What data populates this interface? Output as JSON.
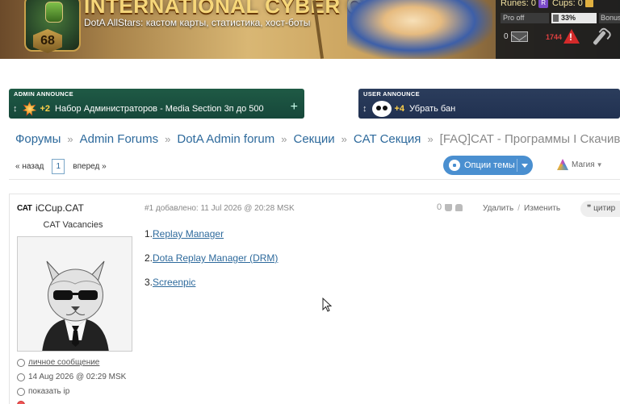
{
  "header": {
    "site_title": "INTERNATIONAL CYBER CUP",
    "site_subtitle": "DotA AllStars: кастом карты, статистика, хост-боты",
    "level": "68"
  },
  "user_panel": {
    "runes_label": "Runes: 0",
    "rune_icon_letter": "R",
    "cups_label": "Cups: 0",
    "pro_status": "Pro off",
    "armor": "33% Armor",
    "bonus": "Bonus",
    "messages": "0",
    "alerts": "1744"
  },
  "announcements": {
    "admin": {
      "tag": "ADMIN ANNOUNCE",
      "count": "+2",
      "text": "Набор Администраторов - Media Section 3п до 500",
      "expand": "+"
    },
    "user": {
      "tag": "USER ANNOUNCE",
      "count": "+4",
      "text": "Убрать бан"
    }
  },
  "breadcrumb": {
    "items": [
      "Форумы",
      "Admin Forums",
      "DotA Admin forum",
      "Секции",
      "CAT Секция"
    ],
    "current": "[FAQ]CAT - Программы I Скачива",
    "separator": "»"
  },
  "pager": {
    "prev": "« назад",
    "page": "1",
    "next": "вперед »"
  },
  "thread_options": {
    "label": "Опции темы"
  },
  "magic": {
    "label": "Магия"
  },
  "post": {
    "author_logo": "CAT",
    "author_name": "iCCup.CAT",
    "author_rank": "CAT Vacancies",
    "meta": "#1 добавлено: 11 Jul 2026 @ 20:28 MSK",
    "rating": "0",
    "delete": "Удалить",
    "edit": "Изменить",
    "actions_sep": "/",
    "quote": "цитир",
    "profile": {
      "pm": "личное сообщение",
      "date": "14 Aug 2026 @ 02:29 MSK",
      "ip": "показать ip"
    },
    "items": [
      {
        "num": "1.",
        "link": "Replay Manager"
      },
      {
        "num": "2.",
        "link": "Dota Replay Manager (DRM)"
      },
      {
        "num": "3.",
        "link": "Screenpic"
      }
    ]
  }
}
